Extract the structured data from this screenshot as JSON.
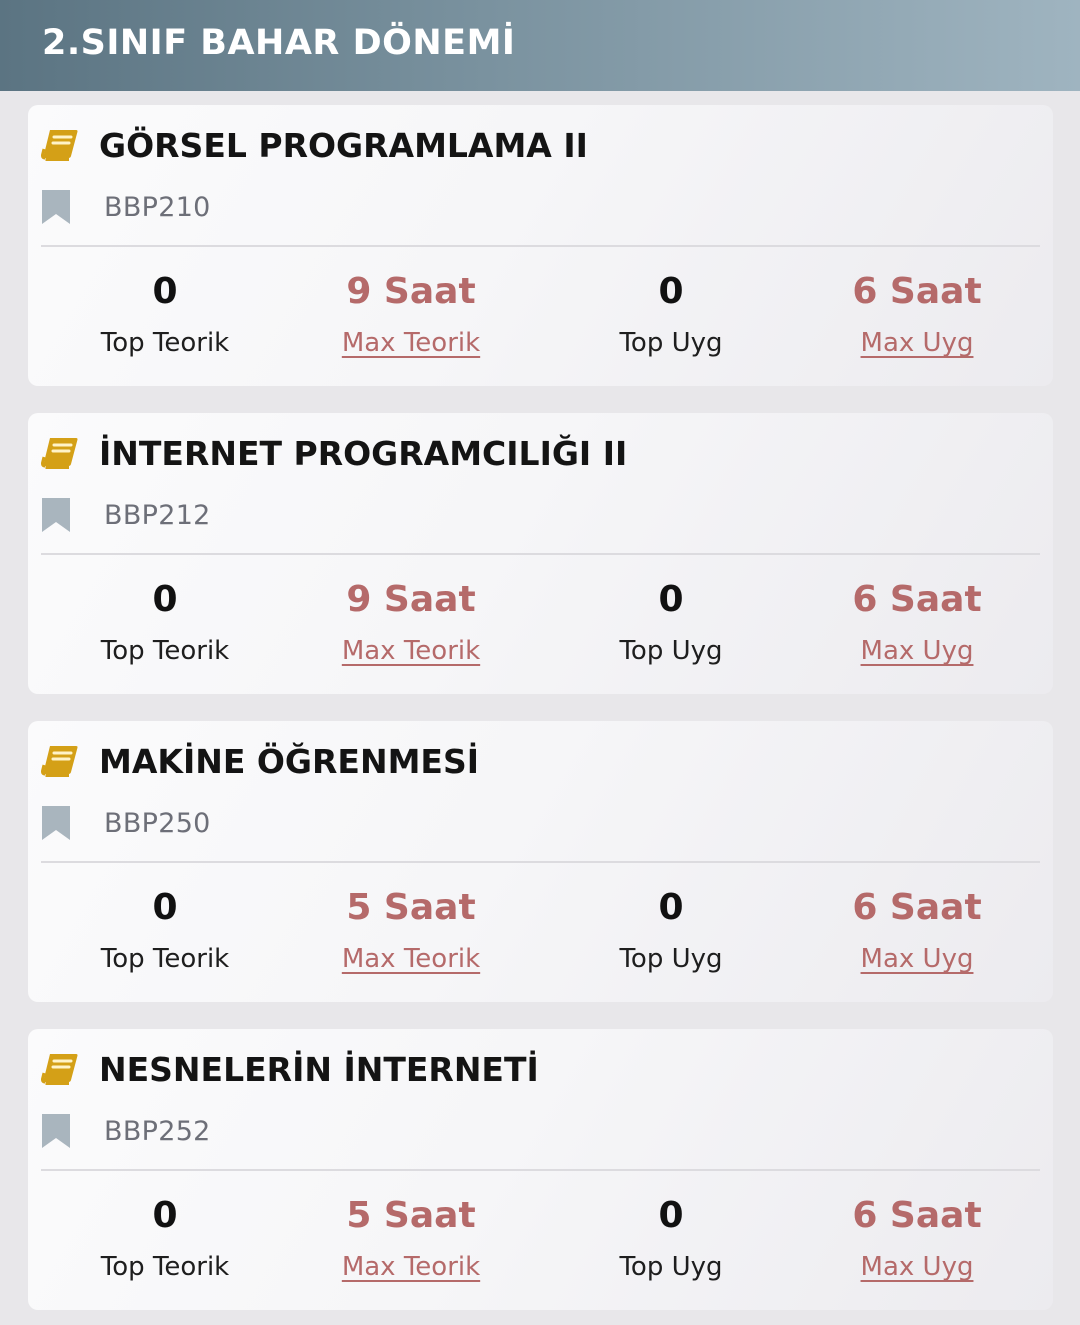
{
  "header": {
    "title": "2.SINIF BAHAR DÖNEMİ"
  },
  "colors": {
    "accent": "#b56a6a",
    "book_icon": "#d4a017",
    "bookmark_icon": "#a9b5be"
  },
  "icons": {
    "course": "book-icon",
    "code": "bookmark-icon"
  },
  "courses": [
    {
      "title": "GÖRSEL PROGRAMLAMA II",
      "code": "BBP210",
      "top_teorik": "0",
      "top_teorik_label": "Top Teorik",
      "max_teorik": "9 Saat",
      "max_teorik_label": "Max Teorik",
      "top_uyg": "0",
      "top_uyg_label": "Top Uyg",
      "max_uyg": "6 Saat",
      "max_uyg_label": "Max Uyg"
    },
    {
      "title": "İNTERNET PROGRAMCILIĞI II",
      "code": "BBP212",
      "top_teorik": "0",
      "top_teorik_label": "Top Teorik",
      "max_teorik": "9 Saat",
      "max_teorik_label": "Max Teorik",
      "top_uyg": "0",
      "top_uyg_label": "Top Uyg",
      "max_uyg": "6 Saat",
      "max_uyg_label": "Max Uyg"
    },
    {
      "title": "MAKİNE ÖĞRENMESİ",
      "code": "BBP250",
      "top_teorik": "0",
      "top_teorik_label": "Top Teorik",
      "max_teorik": "5 Saat",
      "max_teorik_label": "Max Teorik",
      "top_uyg": "0",
      "top_uyg_label": "Top Uyg",
      "max_uyg": "6 Saat",
      "max_uyg_label": "Max Uyg"
    },
    {
      "title": "NESNELERİN İNTERNETİ",
      "code": "BBP252",
      "top_teorik": "0",
      "top_teorik_label": "Top Teorik",
      "max_teorik": "5 Saat",
      "max_teorik_label": "Max Teorik",
      "top_uyg": "0",
      "top_uyg_label": "Top Uyg",
      "max_uyg": "6 Saat",
      "max_uyg_label": "Max Uyg"
    }
  ]
}
